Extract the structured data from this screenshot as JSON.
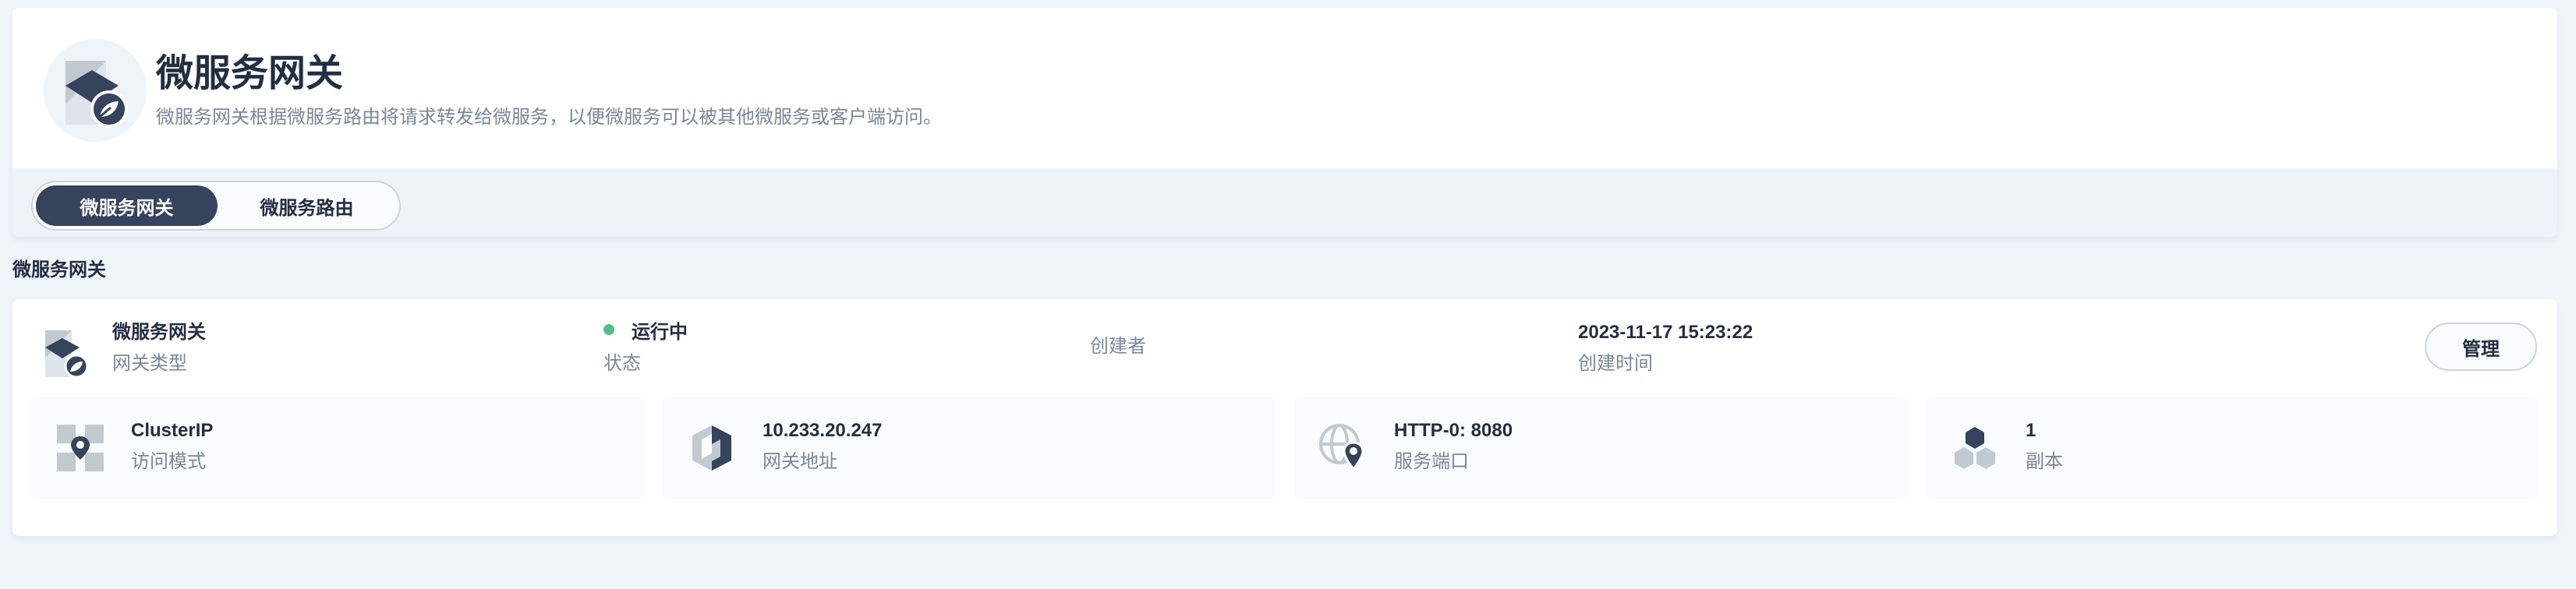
{
  "header": {
    "title": "微服务网关",
    "description": "微服务网关根据微服务路由将请求转发给微服务，以便微服务可以被其他微服务或客户端访问。",
    "icon": "gateway-spring-icon"
  },
  "tabs": [
    {
      "label": "微服务网关",
      "active": true
    },
    {
      "label": "微服务路由",
      "active": false
    }
  ],
  "section": {
    "label": "微服务网关"
  },
  "gateway": {
    "name": "微服务网关",
    "name_label": "网关类型",
    "status": "运行中",
    "status_label": "状态",
    "status_color": "#55bc8a",
    "creator_label": "创建者",
    "created_time": "2023-11-17 15:23:22",
    "created_time_label": "创建时间",
    "manage_label": "管理"
  },
  "stats": [
    {
      "value": "ClusterIP",
      "label": "访问模式",
      "icon": "access-mode-icon"
    },
    {
      "value": "10.233.20.247",
      "label": "网关地址",
      "icon": "gateway-address-icon"
    },
    {
      "value": "HTTP-0: 8080",
      "label": "服务端口",
      "icon": "globe-pin-icon"
    },
    {
      "value": "1",
      "label": "副本",
      "icon": "replicas-icon"
    }
  ],
  "colors": {
    "primary_dark": "#36435c",
    "text": "#242e42",
    "muted": "#79879c",
    "success": "#55bc8a",
    "background": "#eff4f9"
  }
}
